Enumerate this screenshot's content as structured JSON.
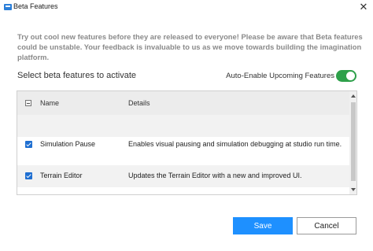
{
  "window": {
    "title": "Beta Features",
    "close_glyph": "✕",
    "icon": "studio-app-icon"
  },
  "intro_text": "Try out cool new features before they are released to everyone! Please be aware that Beta features could be unstable. Your feedback is invaluable to us as we move towards building the imagination platform.",
  "select_heading": "Select beta features to activate",
  "auto_enable": {
    "label": "Auto-Enable Upcoming Features",
    "enabled": true,
    "color": "#2ea04a"
  },
  "table": {
    "columns": {
      "name": "Name",
      "details": "Details"
    },
    "rows": [
      {
        "name": "",
        "details": "",
        "checked": false
      },
      {
        "name": "Simulation Pause",
        "details": "Enables visual pausing and simulation debugging at studio run time.",
        "checked": true
      },
      {
        "name": "Terrain Editor",
        "details": "Updates the Terrain Editor with a new and improved UI.",
        "checked": true
      }
    ]
  },
  "buttons": {
    "save": "Save",
    "cancel": "Cancel",
    "save_color": "#1e90ff"
  }
}
